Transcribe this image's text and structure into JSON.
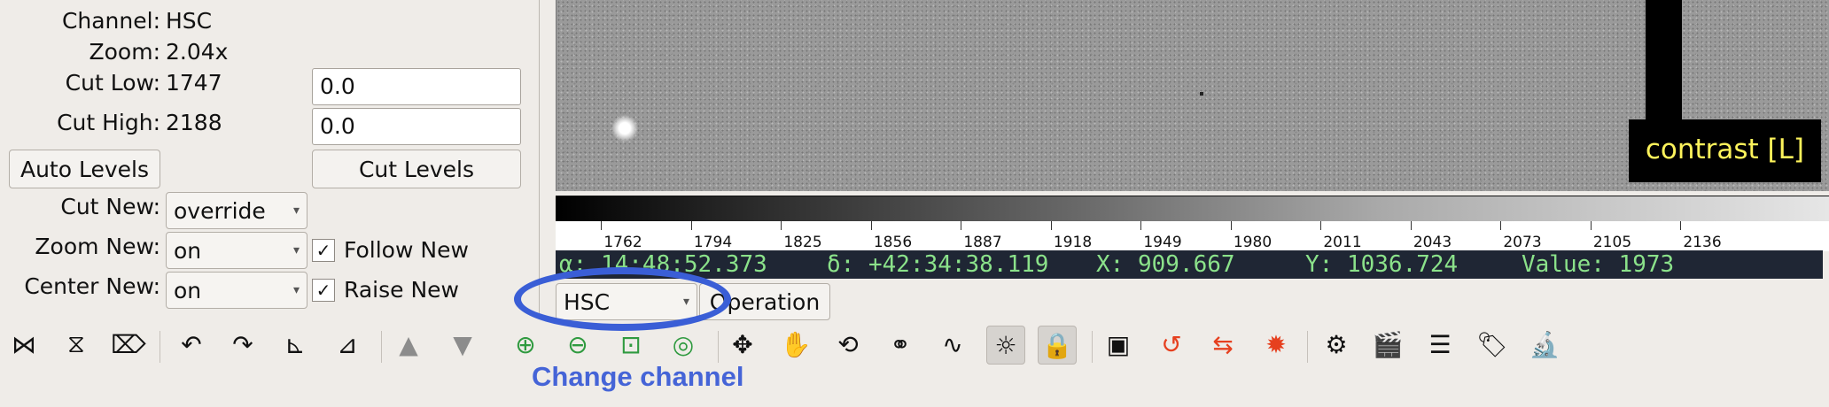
{
  "panel": {
    "channel_label": "Channel:",
    "channel_value": "HSC",
    "zoom_label": "Zoom:",
    "zoom_value": "2.04x",
    "cut_low_label": "Cut Low:",
    "cut_low_value": "1747",
    "cut_low_input": "0.0",
    "cut_high_label": "Cut High:",
    "cut_high_value": "2188",
    "cut_high_input": "0.0",
    "auto_levels_label": "Auto Levels",
    "cut_levels_label": "Cut Levels",
    "cut_new_label": "Cut New:",
    "cut_new_value": "override",
    "zoom_new_label": "Zoom New:",
    "zoom_new_value": "on",
    "center_new_label": "Center New:",
    "center_new_value": "on",
    "follow_new_label": "Follow New",
    "raise_new_label": "Raise New",
    "follow_new_checked": true,
    "raise_new_checked": true
  },
  "image": {
    "overlay_label": "contrast [L]"
  },
  "colorbar": {
    "ticks": [
      "1762",
      "1794",
      "1825",
      "1856",
      "1887",
      "1918",
      "1949",
      "1980",
      "2011",
      "2043",
      "2073",
      "2105",
      "2136"
    ]
  },
  "status": {
    "ra": "α: 14:48:52.373",
    "dec": "δ: +42:34:38.119",
    "x": "X: 909.667",
    "y": "Y: 1036.724",
    "value": "Value: 1973"
  },
  "channel_selector": {
    "value": "HSC",
    "operation_label": "Operation"
  },
  "callout": {
    "text": "Change channel"
  },
  "toolbar_icons": [
    "flip-x-icon",
    "flip-y-icon",
    "swap-xy-icon",
    "rotate-ccw-icon",
    "rotate-cw-icon",
    "orient-ne-icon",
    "orient-en-icon",
    "up-icon",
    "down-icon",
    "zoom-in-icon",
    "zoom-out-icon",
    "zoom-fit-icon",
    "zoom-100-icon",
    "pan-icon",
    "hand-icon",
    "rotate-reset-icon",
    "distribution-icon",
    "curve-icon",
    "contrast-icon",
    "lock-icon",
    "screen-icon",
    "undo-cut-icon",
    "reset-cut-icon",
    "reset-color-icon",
    "settings-icon",
    "clapper-icon",
    "layers-icon",
    "tags-icon",
    "microscope-icon"
  ],
  "colors": {
    "accent": "#3a5ed6",
    "status_bg": "#1f2634",
    "status_text": "#8be28a",
    "overlay_text": "#fdf35b",
    "highlight_arrow": "#e6401f"
  }
}
